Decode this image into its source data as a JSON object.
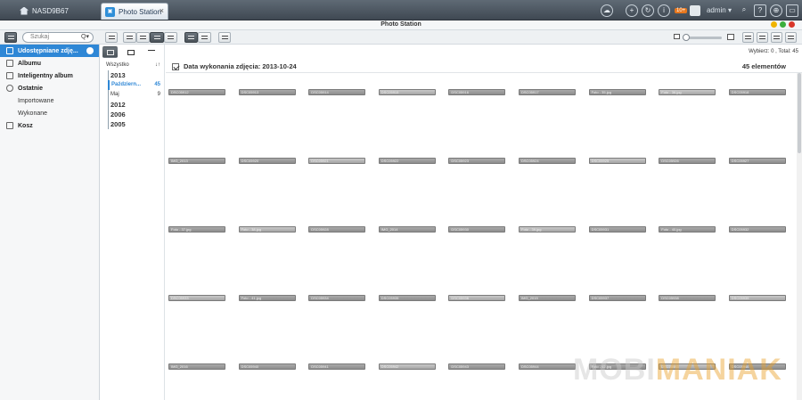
{
  "topbar": {
    "host": "NASD9B67",
    "app_tab": "Photo Station",
    "tab_close": "×",
    "badge": "10+",
    "user": "admin ▾"
  },
  "window": {
    "title": "Photo Station"
  },
  "toolbar": {
    "search_placeholder": "Szukaj",
    "search_icon": "Q▾"
  },
  "sidebar": {
    "items": [
      {
        "label": "Udostępniane zdję...",
        "active": true,
        "icon": "share-icon"
      },
      {
        "label": "Albumu",
        "icon": "album-icon"
      },
      {
        "label": "Inteligentny album",
        "icon": "smart-album-icon"
      },
      {
        "label": "Ostatnie",
        "icon": "clock-icon"
      }
    ],
    "sub_items": [
      "Importowane",
      "Wykonane"
    ],
    "trash": "Kosz"
  },
  "timeline": {
    "all_label": "Wszystko",
    "sort_icon": "↓↑",
    "entries": [
      {
        "kind": "year",
        "label": "2013"
      },
      {
        "kind": "month",
        "label": "Październ...",
        "count": "45",
        "active": true
      },
      {
        "kind": "month",
        "label": "Maj",
        "count": "9"
      },
      {
        "kind": "year",
        "label": "2012"
      },
      {
        "kind": "year",
        "label": "2006"
      },
      {
        "kind": "year",
        "label": "2005"
      }
    ]
  },
  "main": {
    "selection_info": "Wybierz: 0 , Total: 45",
    "date_label": "Data wykonania zdjęcia: 2013-10-24",
    "count_label": "45 elementów",
    "watermark_a": "MOBI",
    "watermark_b": "MANIAK",
    "thumbnails": [
      "DSC05912",
      "DSC05913",
      "DSC05914",
      "DSC05915",
      "DSC05916",
      "DSC05917",
      "Foto - 35.jpg",
      "Foto - 36.jpg",
      "DSC05918",
      "IMG_2013",
      "DSC05920",
      "DSC05921",
      "DSC05922",
      "DSC05923",
      "DSC05924",
      "DSC05925",
      "DSC05926",
      "DSC05927",
      "Foto - 37.jpg",
      "Foto - 38.jpg",
      "DSC05928",
      "IMG_2014",
      "DSC05930",
      "Foto - 39.jpg",
      "DSC05931",
      "Foto - 40.jpg",
      "DSC05932",
      "DSC05933",
      "Foto - 41.jpg",
      "DSC05934",
      "DSC05935",
      "DSC05936",
      "IMG_2015",
      "DSC05937",
      "DSC05938",
      "DSC05939",
      "IMG_2016",
      "DSC05940",
      "DSC05941",
      "DSC05942",
      "DSC05943",
      "DSC05944",
      "Foto - 42.jpg",
      "DSC05945",
      "DSC05946"
    ]
  }
}
